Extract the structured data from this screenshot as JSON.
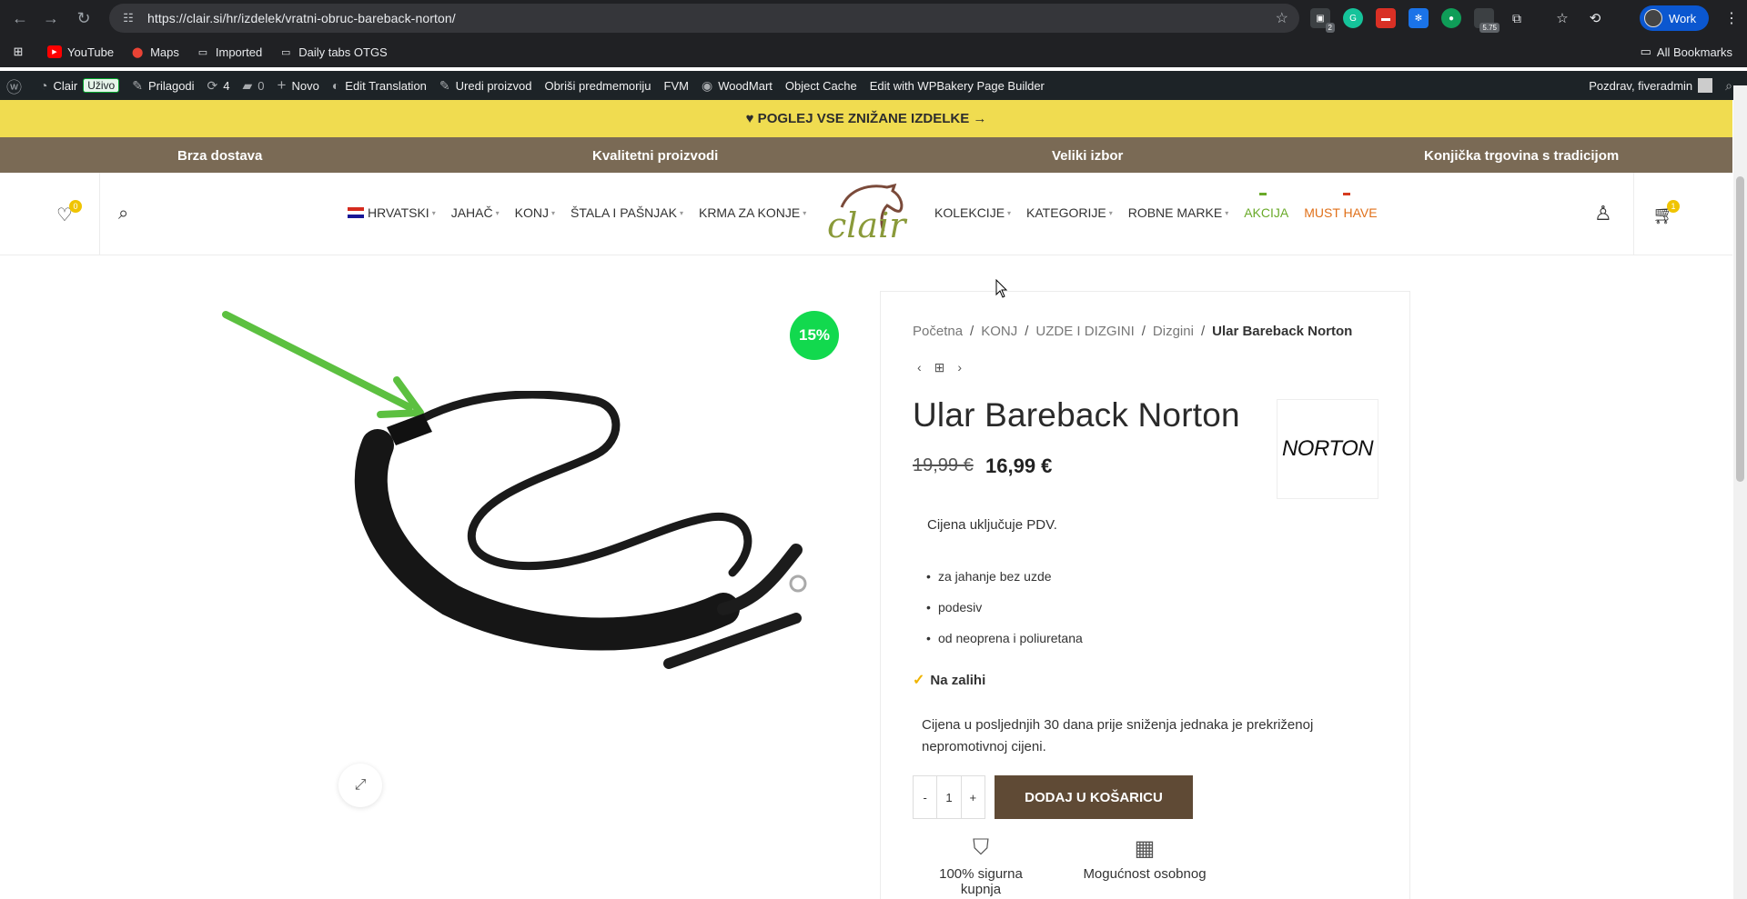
{
  "browser": {
    "url": "https://clair.si/hr/izdelek/vratni-obruc-bareback-norton/",
    "extension_count_1": "2",
    "extension_count_2": "5.75",
    "profile_label": "Work"
  },
  "bookmarks": {
    "items": [
      "YouTube",
      "Maps",
      "Imported",
      "Daily tabs OTGS"
    ],
    "all_label": "All Bookmarks"
  },
  "wpbar": {
    "site": "Clair",
    "live": "Uživo",
    "customize": "Prilagodi",
    "updates": "4",
    "comments": "0",
    "new": "Novo",
    "translate": "Edit Translation",
    "edit_product": "Uredi proizvod",
    "purge": "Obriši predmemoriju",
    "fvm": "FVM",
    "woodmart": "WoodMart",
    "object_cache": "Object Cache",
    "wpbakery": "Edit with WPBakery Page Builder",
    "greeting": "Pozdrav, fiveradmin"
  },
  "promo": {
    "text": "♥ POGLEJ VSE ZNIŽANE IZDELKE →"
  },
  "benefits": [
    "Brza dostava",
    "Kvalitetni proizvodi",
    "Veliki izbor",
    "Konjička trgovina s tradicijom"
  ],
  "header": {
    "wishlist_count": "0",
    "cart_count": "1",
    "logo_text": "clair",
    "nav_left": [
      "HRVATSKI",
      "JAHAČ",
      "KONJ",
      "ŠTALA I PAŠNJAK",
      "KRMA ZA KONJE"
    ],
    "nav_right": [
      "KOLEKCIJE",
      "KATEGORIJE",
      "ROBNE MARKE",
      "AKCIJA",
      "MUST HAVE"
    ]
  },
  "product": {
    "discount": "15%",
    "breadcrumbs": [
      "Početna",
      "KONJ",
      "UZDE I DIZGINI",
      "Dizgini",
      "Ular Bareback Norton"
    ],
    "title": "Ular Bareback Norton",
    "old_price": "19,99 €",
    "new_price": "16,99 €",
    "brand": "NORTON",
    "vat_note": "Cijena uključuje PDV.",
    "features": [
      "za jahanje bez uzde",
      "podesiv",
      "od neoprena i poliuretana"
    ],
    "stock": "Na zalihi",
    "price_note": "Cijena u posljednjih 30 dana prije sniženja jednaka je prekriženoj nepromotivnoj cijeni.",
    "qty_minus": "-",
    "qty_value": "1",
    "qty_plus": "+",
    "add_to_cart": "DODAJ U KOŠARICU",
    "trust_1": "100% sigurna kupnja",
    "trust_2": "Mogućnost osobnog"
  },
  "colors": {
    "promo_bg": "#f0dc50",
    "benefits_bg": "#7a6a55",
    "add_btn": "#5f4a35",
    "discount_badge": "#12d94e",
    "akcija": "#6aaa2a",
    "must_have": "#e0701a",
    "logo_green": "#8a9a3a",
    "arrow": "#5cc040"
  }
}
